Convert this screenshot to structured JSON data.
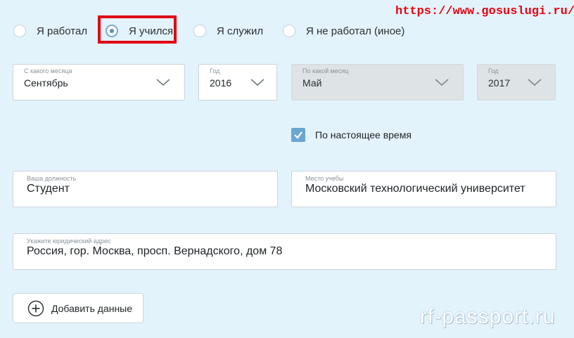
{
  "watermarks": {
    "top": "https://www.gosuslugi.ru/",
    "bottom": "rf-passport.ru"
  },
  "activity_radios": [
    {
      "label": "Я работал",
      "selected": false
    },
    {
      "label": "Я учился",
      "selected": true
    },
    {
      "label": "Я служил",
      "selected": false
    },
    {
      "label": "Я не работал (иное)",
      "selected": false
    }
  ],
  "period": {
    "from_month": {
      "label": "С какого месяца",
      "value": "Сентябрь"
    },
    "from_year": {
      "label": "Год",
      "value": "2016"
    },
    "to_month": {
      "label": "По какой месяц",
      "value": "Май"
    },
    "to_year": {
      "label": "Год",
      "value": "2017"
    }
  },
  "present_checkbox": {
    "label": "По настоящее время",
    "checked": true
  },
  "position_field": {
    "label": "Ваша должность",
    "value": "Студент"
  },
  "place_field": {
    "label": "Место учебы",
    "value": "Московский технологический университет"
  },
  "address_field": {
    "label": "Укажите юридический адрес",
    "value": "Россия, гор. Москва, просп. Вернадского, дом 78"
  },
  "add_button": {
    "label": "Добавить данные"
  },
  "colors": {
    "background": "#e3f3fc",
    "accent": "#6aa6cf",
    "highlight": "#e00014",
    "watermark": "#e30613"
  }
}
